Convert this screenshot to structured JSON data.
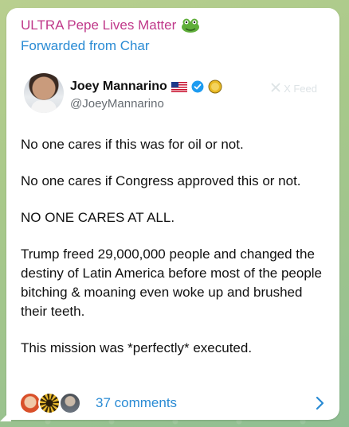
{
  "message": {
    "sender_name": "ULTRA Pepe Lives Matter",
    "sender_icon": "frog-icon",
    "forwarded_from": "Forwarded from Char"
  },
  "tweet": {
    "display_name": "Joey Mannarino",
    "handle": "@JoeyMannarino",
    "badges": [
      "us-flag-icon",
      "verified-icon",
      "coin-icon"
    ],
    "watermark": "X Feed",
    "paragraphs": [
      "No one cares if this was for oil or not.",
      "No one cares if Congress approved this or not.",
      "NO ONE CARES AT ALL.",
      "Trump freed 29,000,000 people and changed the destiny of Latin America before most of the people bitching & moaning even woke up and brushed their teeth.",
      "This mission was *perfectly* executed."
    ]
  },
  "comments": {
    "label": "37 comments",
    "avatars": [
      "commenter-avatar-1",
      "commenter-avatar-2",
      "commenter-avatar-3"
    ]
  },
  "colors": {
    "sender": "#c0398a",
    "link": "#2a8bd4",
    "text": "#111111",
    "handle": "#666c72"
  }
}
